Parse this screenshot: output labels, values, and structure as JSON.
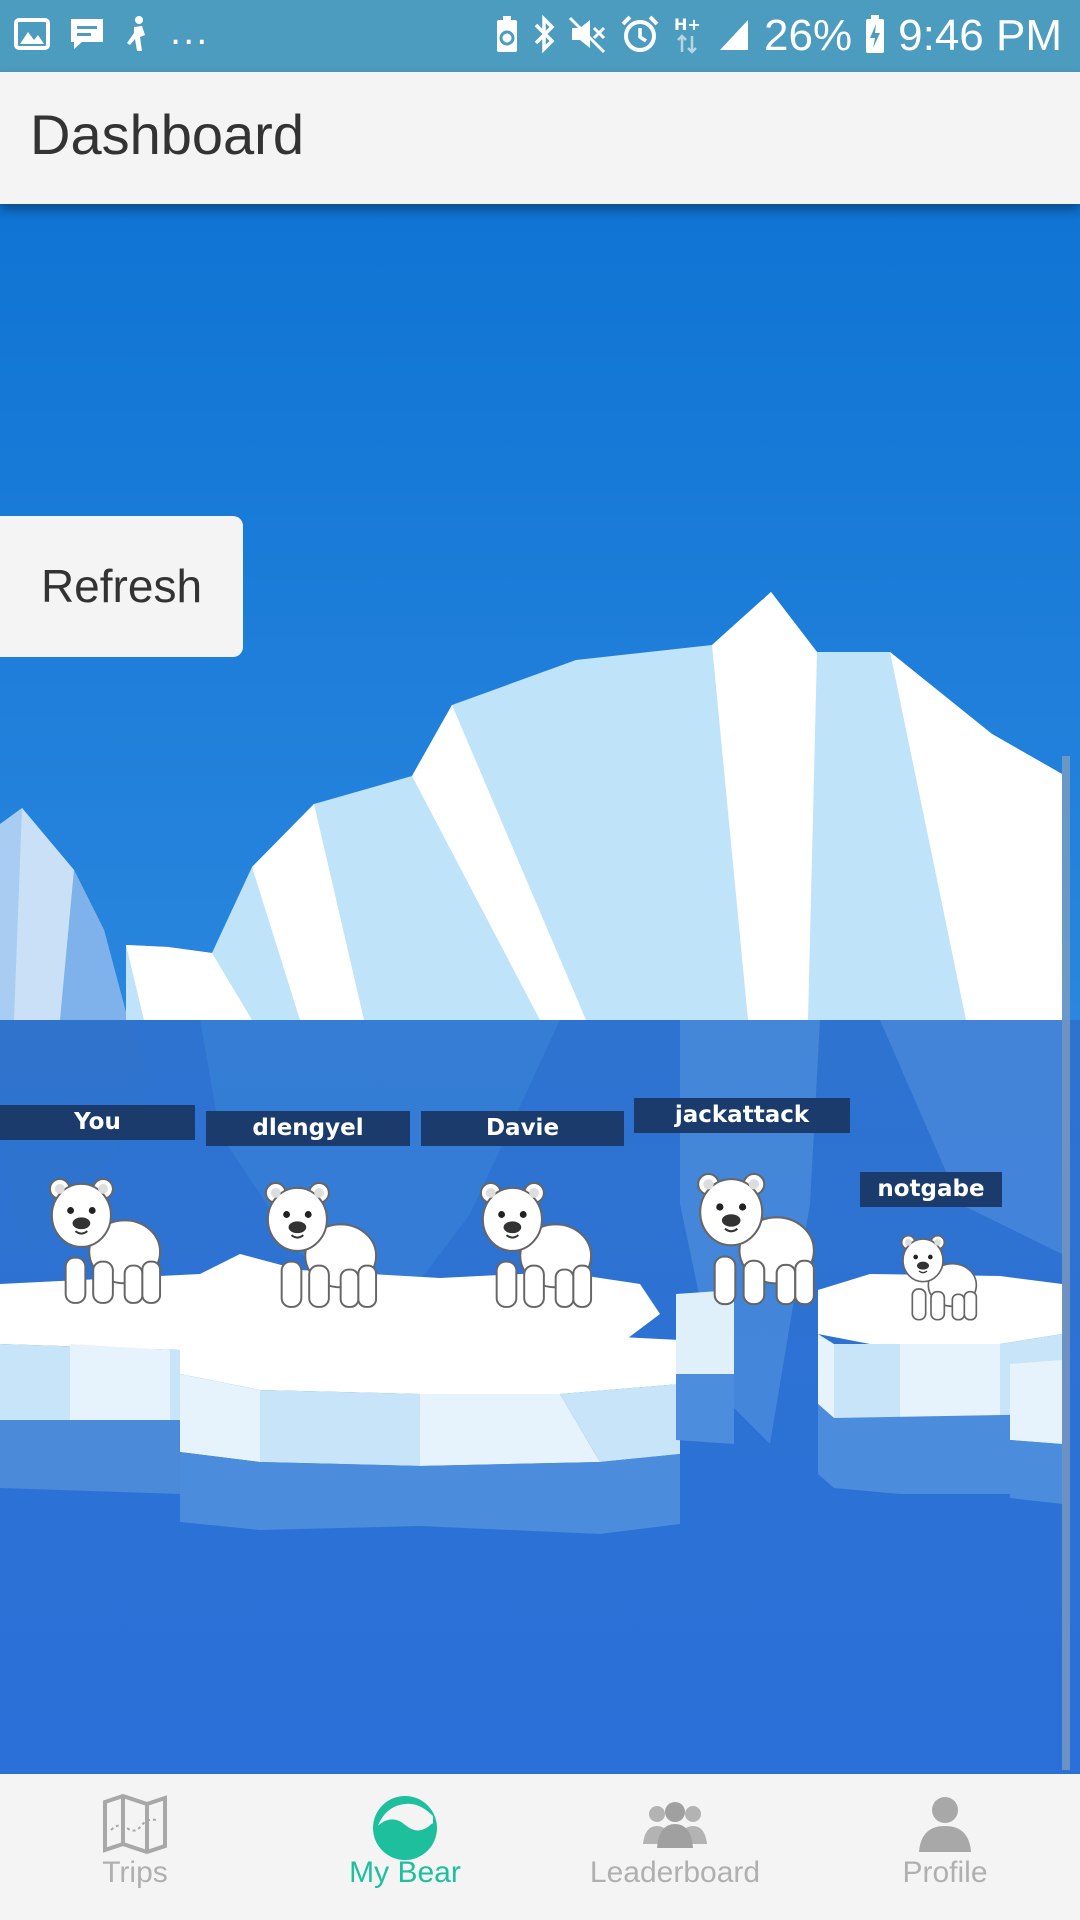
{
  "status_bar": {
    "battery_percent": "26%",
    "time": "9:46 PM",
    "network": "H+",
    "overflow": "..."
  },
  "app_bar": {
    "title": "Dashboard"
  },
  "actions": {
    "refresh_label": "Refresh"
  },
  "bears": [
    {
      "name": "You"
    },
    {
      "name": "dlengyel"
    },
    {
      "name": "Davie"
    },
    {
      "name": "jackattack"
    },
    {
      "name": "notgabe"
    }
  ],
  "bottom_nav": {
    "items": [
      {
        "label": "Trips",
        "icon": "map-icon",
        "active": false
      },
      {
        "label": "My Bear",
        "icon": "bear-wave-icon",
        "active": true
      },
      {
        "label": "Leaderboard",
        "icon": "group-icon",
        "active": false
      },
      {
        "label": "Profile",
        "icon": "person-icon",
        "active": false
      }
    ]
  },
  "colors": {
    "status_bar": "#4b9cbf",
    "accent": "#1dbf9c",
    "sky": "#1c78d4",
    "water": "#2a6fd4",
    "name_tag": "#1a3b6b"
  }
}
